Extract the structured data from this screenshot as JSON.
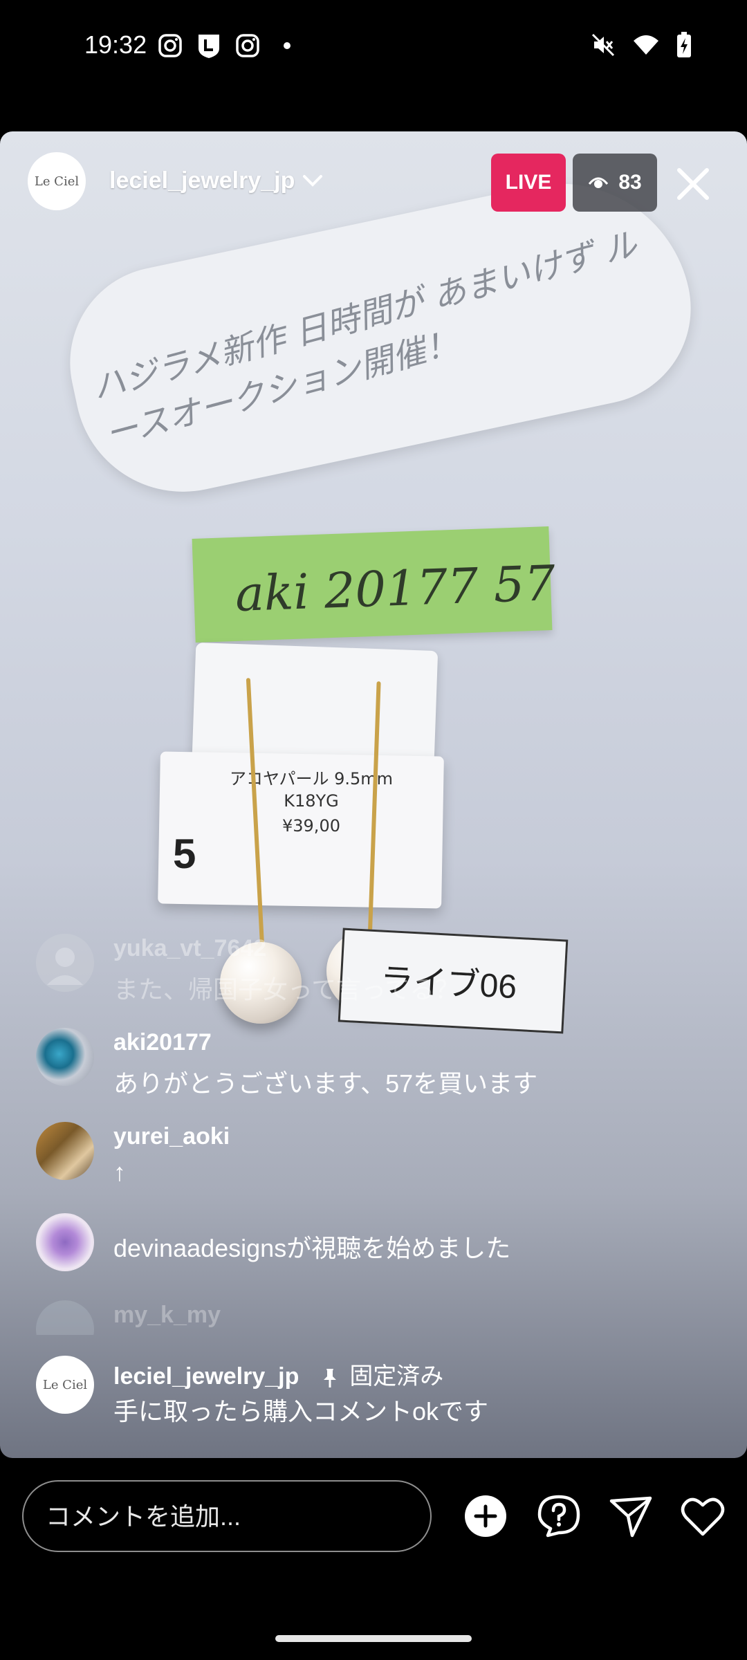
{
  "status_bar": {
    "time": "19:32",
    "left_icons": [
      "instagram-icon",
      "line-icon",
      "instagram-icon",
      "notification-dot"
    ],
    "right_icons": [
      "muted-icon",
      "wifi-icon",
      "battery-charging-icon"
    ]
  },
  "header": {
    "avatar_text": "Le Ciel",
    "username": "leciel_jewelry_jp",
    "live_label": "LIVE",
    "viewer_count": "83"
  },
  "video": {
    "note_text": "ハジラメ新作 日時間が あまいけず ルースオークション開催！",
    "sticky_text": "aki 20177 57",
    "card_label": "アコヤパール 9.5mm K18YG",
    "card_price": "¥39,00",
    "card_number": "5",
    "tag_text": "ライブ06"
  },
  "comments": [
    {
      "user": "yuka_vt_7642",
      "message": "また、帰国子女って言ってる？"
    },
    {
      "user": "aki20177",
      "message": "ありがとうございます、57を買います"
    },
    {
      "user": "yurei_aoki",
      "message": "↑"
    },
    {
      "joined_text": "devinaadesignsが視聴を始めました"
    },
    {
      "user": "my_k_my"
    }
  ],
  "pinned": {
    "user": "leciel_jewelry_jp",
    "pinned_label": "固定済み",
    "message": "手に取ったら購入コメントokです",
    "avatar_text": "Le Ciel"
  },
  "bottom_bar": {
    "comment_placeholder": "コメントを追加..."
  },
  "colors": {
    "live": "#e5275f",
    "background": "#000000"
  }
}
